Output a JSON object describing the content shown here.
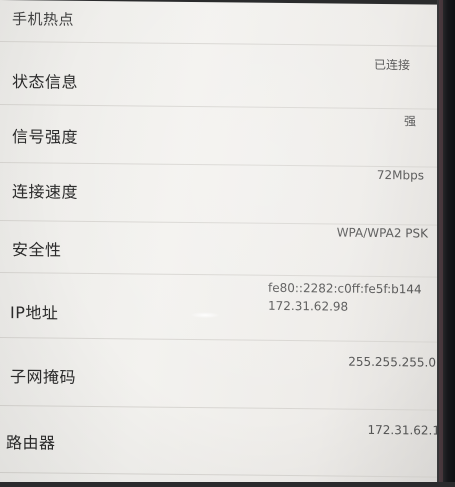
{
  "header": {
    "label": "手机热点"
  },
  "rows": [
    {
      "label": "状态信息",
      "value": "已连接"
    },
    {
      "label": "信号强度",
      "value": "强"
    },
    {
      "label": "连接速度",
      "value": "72Mbps"
    },
    {
      "label": "安全性",
      "value": "WPA/WPA2 PSK"
    },
    {
      "label": "IP地址",
      "value_line1": "fe80::2282:c0ff:fe5f:b144",
      "value_line2": "172.31.62.98"
    },
    {
      "label": "子网掩码",
      "value": "255.255.255.0"
    },
    {
      "label": "路由器",
      "value": "172.31.62.1"
    }
  ]
}
